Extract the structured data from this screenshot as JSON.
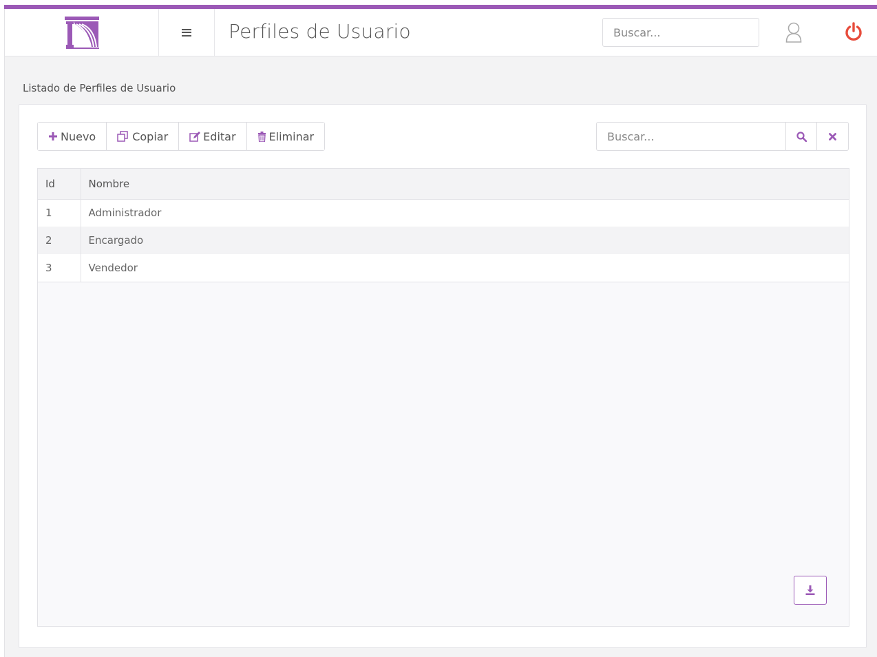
{
  "colors": {
    "accent": "#9b59b6",
    "power": "#e74c3c"
  },
  "header": {
    "title": "Perfiles de Usuario",
    "search_placeholder": "Buscar..."
  },
  "section": {
    "title": "Listado de Perfiles de Usuario"
  },
  "toolbar": {
    "nuevo": "Nuevo",
    "copiar": "Copiar",
    "editar": "Editar",
    "eliminar": "Eliminar",
    "search_placeholder": "Buscar..."
  },
  "table": {
    "columns": [
      "Id",
      "Nombre"
    ],
    "rows": [
      [
        "1",
        "Administrador"
      ],
      [
        "2",
        "Encargado"
      ],
      [
        "3",
        "Vendedor"
      ]
    ]
  },
  "icons": {
    "menu": "hamburger-icon",
    "user": "user-icon",
    "power": "power-icon",
    "nuevo": "plus-icon",
    "copiar": "copy-icon",
    "editar": "edit-icon",
    "eliminar": "trash-icon",
    "search": "search-icon",
    "clear": "close-icon",
    "export": "download-icon"
  }
}
